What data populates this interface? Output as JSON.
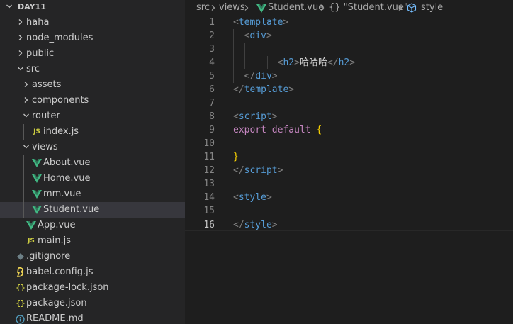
{
  "explorer": {
    "root": "DAY11",
    "items": [
      {
        "label": "haha",
        "kind": "folder",
        "expanded": false
      },
      {
        "label": "node_modules",
        "kind": "folder",
        "expanded": false
      },
      {
        "label": "public",
        "kind": "folder",
        "expanded": false
      },
      {
        "label": "src",
        "kind": "folder",
        "expanded": true
      },
      {
        "label": "assets",
        "kind": "folder",
        "expanded": false
      },
      {
        "label": "components",
        "kind": "folder",
        "expanded": false
      },
      {
        "label": "router",
        "kind": "folder",
        "expanded": true
      },
      {
        "label": "index.js",
        "kind": "js",
        "icon_text": "JS"
      },
      {
        "label": "views",
        "kind": "folder",
        "expanded": true
      },
      {
        "label": "About.vue",
        "kind": "vue"
      },
      {
        "label": "Home.vue",
        "kind": "vue"
      },
      {
        "label": "mm.vue",
        "kind": "vue"
      },
      {
        "label": "Student.vue",
        "kind": "vue",
        "selected": true
      },
      {
        "label": "App.vue",
        "kind": "vue"
      },
      {
        "label": "main.js",
        "kind": "js",
        "icon_text": "JS"
      },
      {
        "label": ".gitignore",
        "kind": "git"
      },
      {
        "label": "babel.config.js",
        "kind": "babel"
      },
      {
        "label": "package-lock.json",
        "kind": "json",
        "icon_text": "{}"
      },
      {
        "label": "package.json",
        "kind": "json",
        "icon_text": "{}"
      },
      {
        "label": "README.md",
        "kind": "info"
      }
    ]
  },
  "breadcrumb": {
    "parts": [
      "src",
      "views",
      "Student.vue",
      "{} \"Student.vue\"",
      "style"
    ]
  },
  "editor": {
    "current_line": 16,
    "lines": [
      {
        "n": "1",
        "tokens": [
          [
            "tk-bracket",
            "<"
          ],
          [
            "tk-tag",
            "template"
          ],
          [
            "tk-bracket",
            ">"
          ]
        ]
      },
      {
        "n": "2",
        "tokens": [
          [
            "tk-text",
            "  "
          ],
          [
            "tk-bracket",
            "<"
          ],
          [
            "tk-tag",
            "div"
          ],
          [
            "tk-bracket",
            ">"
          ]
        ]
      },
      {
        "n": "3",
        "tokens": []
      },
      {
        "n": "4",
        "tokens": [
          [
            "tk-text",
            "        "
          ],
          [
            "tk-bracket",
            "<"
          ],
          [
            "tk-tag",
            "h2"
          ],
          [
            "tk-bracket",
            ">"
          ],
          [
            "tk-text",
            "哈哈哈"
          ],
          [
            "tk-bracket",
            "</"
          ],
          [
            "tk-tag",
            "h2"
          ],
          [
            "tk-bracket",
            ">"
          ]
        ]
      },
      {
        "n": "5",
        "tokens": [
          [
            "tk-text",
            "  "
          ],
          [
            "tk-bracket",
            "</"
          ],
          [
            "tk-tag",
            "div"
          ],
          [
            "tk-bracket",
            ">"
          ]
        ]
      },
      {
        "n": "6",
        "tokens": [
          [
            "tk-bracket",
            "</"
          ],
          [
            "tk-tag",
            "template"
          ],
          [
            "tk-bracket",
            ">"
          ]
        ]
      },
      {
        "n": "7",
        "tokens": []
      },
      {
        "n": "8",
        "tokens": [
          [
            "tk-bracket",
            "<"
          ],
          [
            "tk-tag",
            "script"
          ],
          [
            "tk-bracket",
            ">"
          ]
        ]
      },
      {
        "n": "9",
        "tokens": [
          [
            "tk-kw",
            "export"
          ],
          [
            "tk-text",
            " "
          ],
          [
            "tk-kw",
            "default"
          ],
          [
            "tk-text",
            " "
          ],
          [
            "tk-brace",
            "{"
          ]
        ]
      },
      {
        "n": "10",
        "tokens": []
      },
      {
        "n": "11",
        "tokens": [
          [
            "tk-brace",
            "}"
          ]
        ]
      },
      {
        "n": "12",
        "tokens": [
          [
            "tk-bracket",
            "</"
          ],
          [
            "tk-tag",
            "script"
          ],
          [
            "tk-bracket",
            ">"
          ]
        ]
      },
      {
        "n": "13",
        "tokens": []
      },
      {
        "n": "14",
        "tokens": [
          [
            "tk-bracket",
            "<"
          ],
          [
            "tk-tag",
            "style"
          ],
          [
            "tk-bracket",
            ">"
          ]
        ]
      },
      {
        "n": "15",
        "tokens": []
      },
      {
        "n": "16",
        "tokens": [
          [
            "tk-bracket",
            "</"
          ],
          [
            "tk-tag",
            "style"
          ],
          [
            "tk-bracket",
            ">"
          ]
        ]
      }
    ]
  },
  "colors": {
    "vue_icon": "#41b883",
    "selected_row": "#37373d",
    "tag": "#569cd6",
    "keyword": "#c586c0",
    "brace": "#ffd700"
  }
}
